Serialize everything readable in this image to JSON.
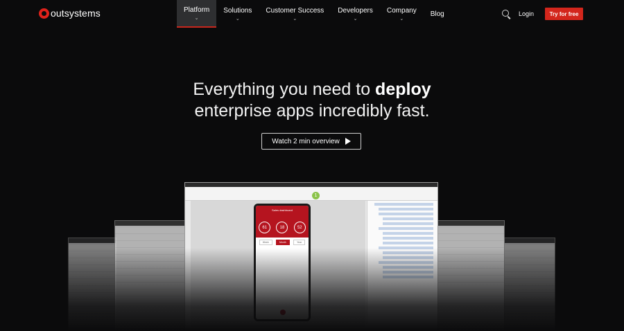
{
  "brand": {
    "name": "outsystems",
    "accent": "#d3261c"
  },
  "nav": {
    "items": [
      {
        "label": "Platform",
        "active": true
      },
      {
        "label": "Solutions"
      },
      {
        "label": "Customer Success"
      },
      {
        "label": "Developers"
      },
      {
        "label": "Company"
      },
      {
        "label": "Blog"
      }
    ],
    "login": "Login",
    "cta": "Try for free",
    "search_icon": "search-icon"
  },
  "hero": {
    "line1_pre": "Everything you need to ",
    "line1_bold": "deploy",
    "line2": "enterprise apps incredibly fast.",
    "watch_label": "Watch 2 min overview"
  },
  "screenshot": {
    "step_badge": "1",
    "phone_title": "Sales dashboard",
    "gauges": [
      "61",
      "18",
      "52"
    ],
    "tabs": [
      "Week",
      "Month",
      "Year"
    ]
  }
}
